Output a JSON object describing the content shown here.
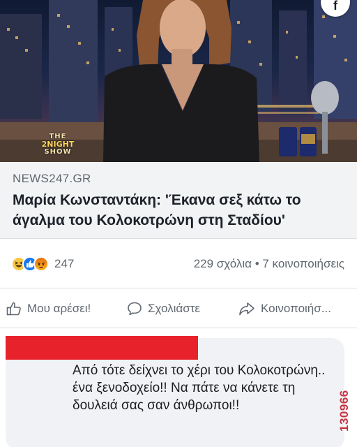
{
  "video": {
    "show_logo_line1": "THE",
    "show_logo_line2": "2NIGHT",
    "show_logo_line3": "SHOW",
    "corner_badge": "f"
  },
  "link_preview": {
    "source": "NEWS247.GR",
    "headline": "Μαρία Κωνσταντάκη: 'Έκανα σεξ κάτω το άγαλμα του Κολοκοτρώνη στη Σταδίου'"
  },
  "reactions": {
    "icons": [
      "haha-icon",
      "like-icon",
      "angry-icon"
    ],
    "count": "247",
    "summary": "229 σχόλια • 7 κοινοποιήσεις"
  },
  "actions": {
    "like_label": "Μου αρέσει!",
    "comment_label": "Σχολιάστε",
    "share_label": "Κοινοποιήσ..."
  },
  "comment": {
    "text": "Από τότε δείχνει το χέρι του Κολοκοτρώνη.. ένα ξενοδοχείο!! Να πάτε να κάνετε τη δουλειά σας σαν άνθρωποι!!",
    "redaction_color": "#e8222b"
  },
  "watermark": "130966",
  "colors": {
    "link_card_bg": "#f2f3f5",
    "meta_text": "#606770",
    "like_blue": "#1877f2"
  }
}
